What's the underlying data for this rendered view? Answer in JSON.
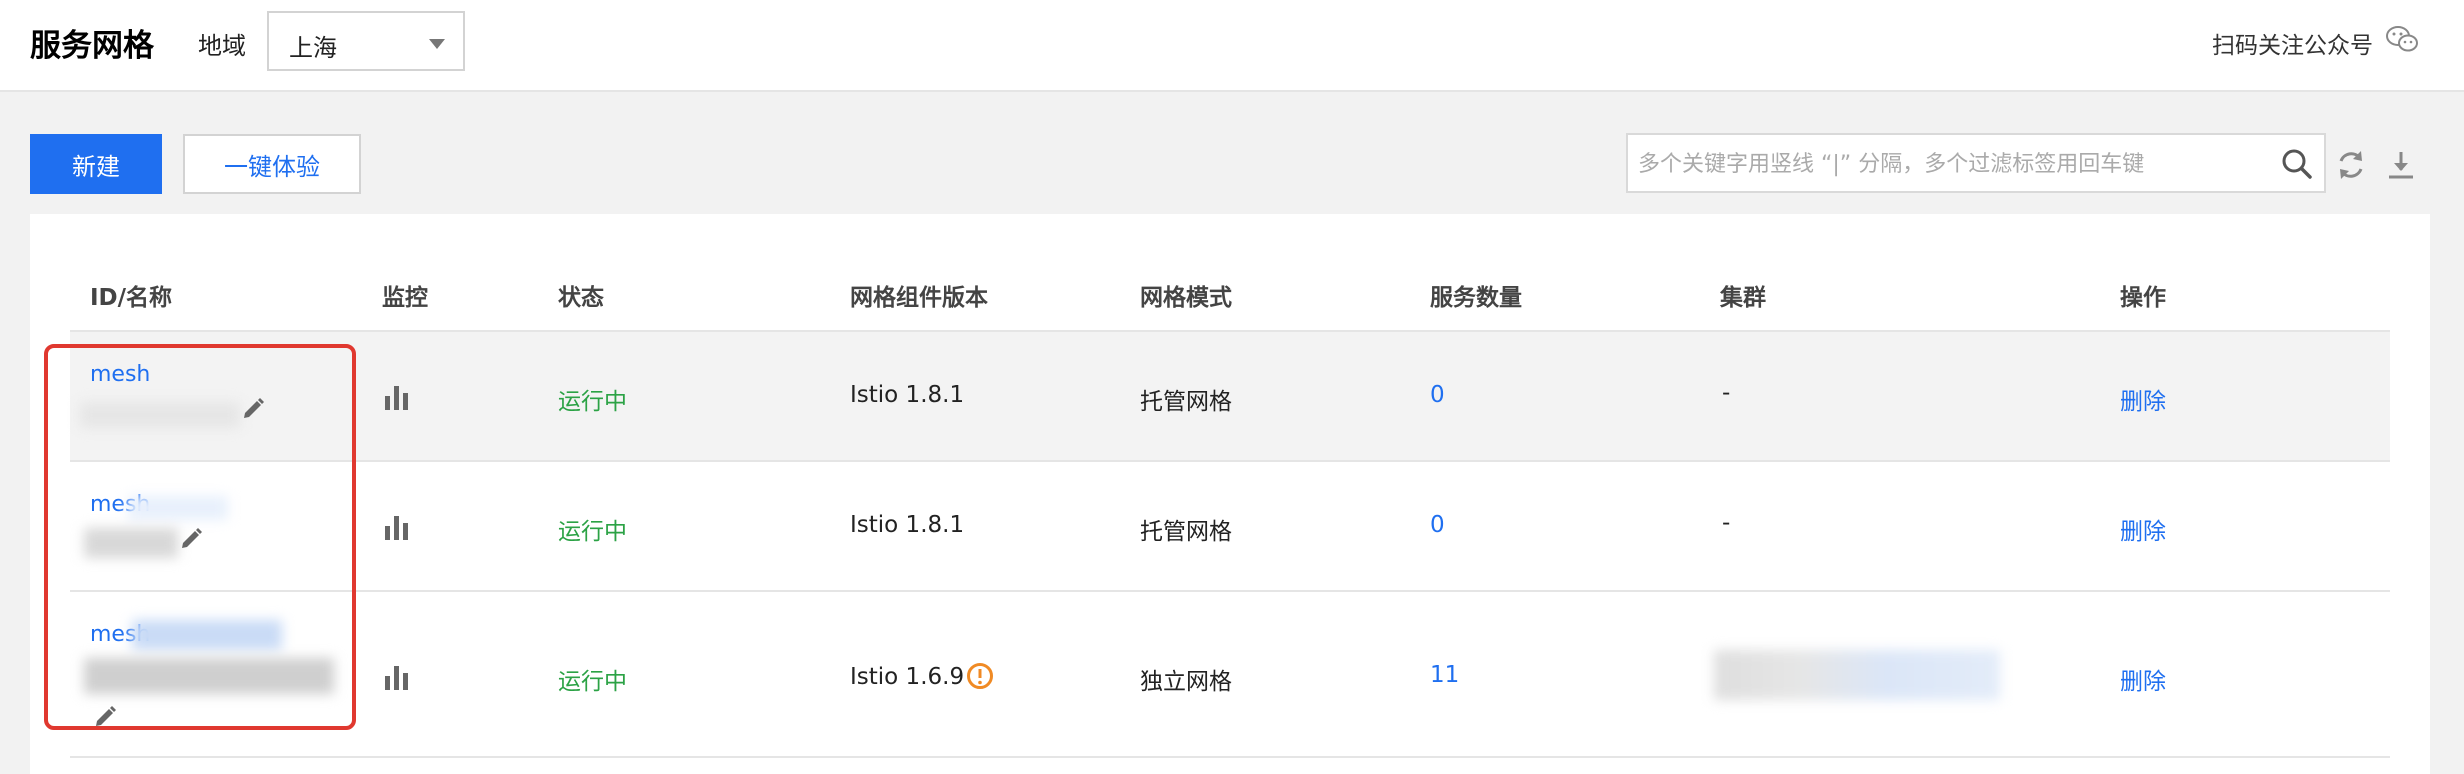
{
  "header": {
    "title": "服务网格",
    "region_label": "地域",
    "region_value": "上海",
    "qr_text": "扫码关注公众号"
  },
  "toolbar": {
    "new_label": "新建",
    "try_label": "一键体验",
    "search_placeholder": "多个关键字用竖线 “|” 分隔，多个过滤标签用回车键"
  },
  "table": {
    "columns": [
      "ID/名称",
      "监控",
      "状态",
      "网格组件版本",
      "网格模式",
      "服务数量",
      "集群",
      "操作"
    ],
    "rows": [
      {
        "id": "mesh",
        "status": "运行中",
        "version": "Istio 1.8.1",
        "mode": "托管网格",
        "services": "0",
        "cluster": "-",
        "action": "删除",
        "warning": false
      },
      {
        "id": "mesh",
        "status": "运行中",
        "version": "Istio 1.8.1",
        "mode": "托管网格",
        "services": "0",
        "cluster": "-",
        "action": "删除",
        "warning": false
      },
      {
        "id": "mesh",
        "status": "运行中",
        "version": "Istio 1.6.9",
        "mode": "独立网格",
        "services": "11",
        "cluster": "",
        "action": "删除",
        "warning": true
      }
    ]
  },
  "colors": {
    "primary": "#1f6ff0",
    "running": "#2ba245",
    "highlight": "#e0382f",
    "warning": "#f08a24"
  }
}
